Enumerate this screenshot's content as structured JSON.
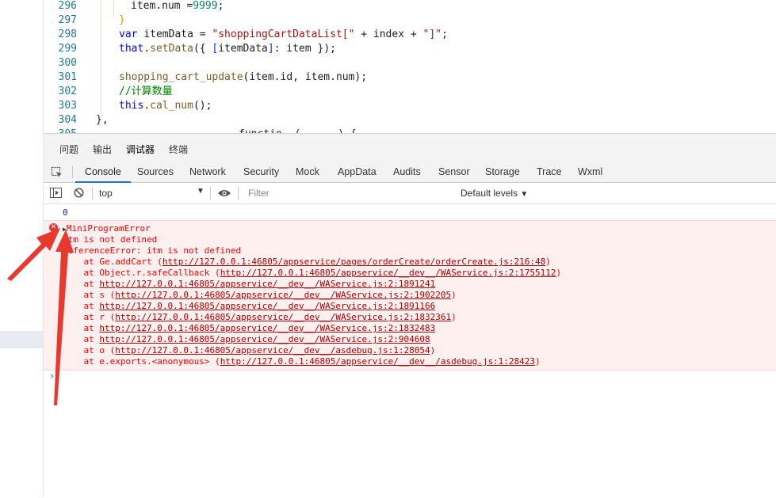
{
  "editor": {
    "lines": [
      {
        "n": "296",
        "parts": [
          [
            "txt",
            "item.num "
          ],
          [
            "txt",
            "="
          ],
          [
            "num",
            "9999"
          ],
          [
            "txt",
            ";"
          ]
        ],
        "indent": 2
      },
      {
        "n": "297",
        "parts": [
          [
            "br2",
            "}"
          ]
        ],
        "indent": 1
      },
      {
        "n": "298",
        "parts": [
          [
            "kw",
            "var "
          ],
          [
            "txt",
            "itemData = "
          ],
          [
            "str",
            "\"shoppingCartDataList[\""
          ],
          [
            "txt",
            " + index + "
          ],
          [
            "str",
            "\"]\""
          ],
          [
            "txt",
            ";"
          ]
        ],
        "indent": 1
      },
      {
        "n": "299",
        "parts": [
          [
            "kw",
            "that"
          ],
          [
            "txt",
            "."
          ],
          [
            "fn",
            "setData"
          ],
          [
            "txt",
            "({ "
          ],
          [
            "br",
            "["
          ],
          [
            "txt",
            "itemData"
          ],
          [
            "br",
            "]"
          ],
          [
            "txt",
            ": item });"
          ]
        ],
        "indent": 1
      },
      {
        "n": "300",
        "parts": [],
        "indent": 1
      },
      {
        "n": "301",
        "parts": [
          [
            "fn",
            "shopping_cart_update"
          ],
          [
            "txt",
            "(item.id, item.num);"
          ]
        ],
        "indent": 1
      },
      {
        "n": "302",
        "parts": [
          [
            "cmt",
            "//计算数量"
          ]
        ],
        "indent": 1
      },
      {
        "n": "303",
        "parts": [
          [
            "kw",
            "this"
          ],
          [
            "txt",
            "."
          ],
          [
            "fn",
            "cal_num"
          ],
          [
            "txt",
            "();"
          ]
        ],
        "indent": 1
      },
      {
        "n": "304",
        "parts": [
          [
            "txt",
            "},"
          ]
        ],
        "indent": 0
      },
      {
        "n": "305",
        "parts": [
          [
            "txt",
            "  ...                  functio  ( ...  ) {"
          ]
        ],
        "indent": 0
      }
    ]
  },
  "panel_tabs": [
    "问题",
    "输出",
    "调试器",
    "终端"
  ],
  "tool_tabs": [
    "Console",
    "Sources",
    "Network",
    "Security",
    "Mock",
    "AppData",
    "Audits",
    "Sensor",
    "Storage",
    "Trace",
    "Wxml"
  ],
  "filterbar": {
    "context": "top",
    "filter_placeholder": "Filter",
    "levels": "Default levels"
  },
  "console": {
    "result_value": "0",
    "error": {
      "title": "MiniProgramError",
      "message": "itm is not defined",
      "reference": "ReferenceError: itm is not defined",
      "stack": [
        {
          "prefix": "    at Ge.addCart (",
          "url": "http://127.0.0.1:46805/appservice/pages/orderCreate/orderCreate.js:216:48",
          "suffix": ")"
        },
        {
          "prefix": "    at Object.r.safeCallback (",
          "url": "http://127.0.0.1:46805/appservice/__dev__/WAService.js:2:1755112",
          "suffix": ")"
        },
        {
          "prefix": "    at ",
          "url": "http://127.0.0.1:46805/appservice/__dev__/WAService.js:2:1891241",
          "suffix": ""
        },
        {
          "prefix": "    at s (",
          "url": "http://127.0.0.1:46805/appservice/__dev__/WAService.js:2:1902205",
          "suffix": ")"
        },
        {
          "prefix": "    at ",
          "url": "http://127.0.0.1:46805/appservice/__dev__/WAService.js:2:1891166",
          "suffix": ""
        },
        {
          "prefix": "    at r (",
          "url": "http://127.0.0.1:46805/appservice/__dev__/WAService.js:2:1832361",
          "suffix": ")"
        },
        {
          "prefix": "    at ",
          "url": "http://127.0.0.1:46805/appservice/__dev__/WAService.js:2:1832483",
          "suffix": ""
        },
        {
          "prefix": "    at ",
          "url": "http://127.0.0.1:46805/appservice/__dev__/WAService.js:2:904608",
          "suffix": ""
        },
        {
          "prefix": "    at o (",
          "url": "http://127.0.0.1:46805/appservice/__dev__/asdebug.js:1:28054",
          "suffix": ")"
        },
        {
          "prefix": "    at e.exports.<anonymous> (",
          "url": "http://127.0.0.1:46805/appservice/__dev__/asdebug.js:1:28423",
          "suffix": ")"
        }
      ]
    },
    "prompt": "›"
  },
  "colors": {
    "accent": "#1a73e8",
    "error_text": "#ff0000",
    "error_bg": "#fff0f0",
    "annotation_arrow": "#e8392e"
  }
}
